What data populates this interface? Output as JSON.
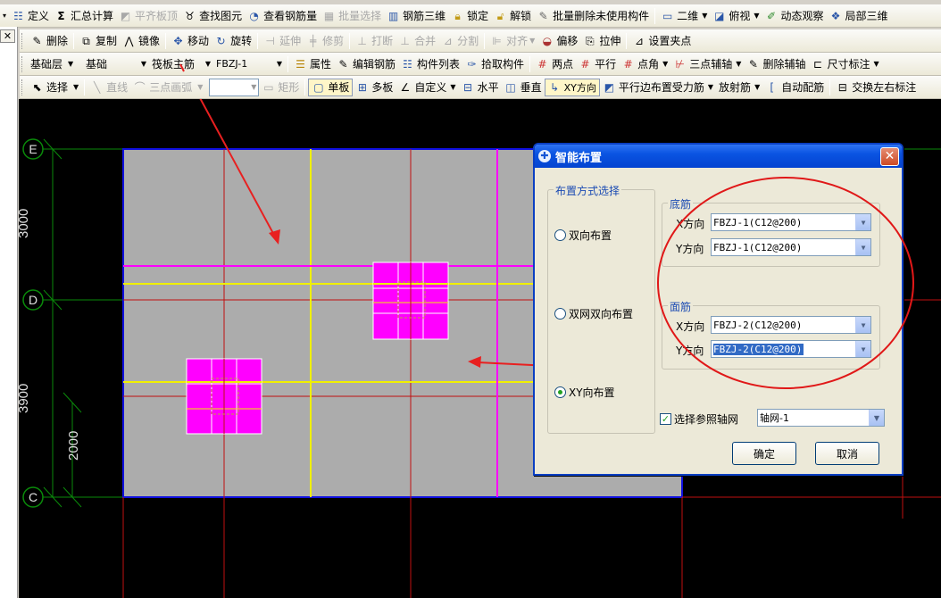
{
  "toolbar1": {
    "items": [
      {
        "label": "定义",
        "icon": "define-icon"
      },
      {
        "label": "汇总计算",
        "icon": "sigma-icon"
      },
      {
        "label": "平齐板顶",
        "icon": "align-top-icon",
        "disabled": true
      },
      {
        "label": "查找图元",
        "icon": "binoculars-icon"
      },
      {
        "label": "查看钢筋量",
        "icon": "view-rebar-icon"
      },
      {
        "label": "批量选择",
        "icon": "batch-select-icon",
        "disabled": true
      },
      {
        "label": "钢筋三维",
        "icon": "rebar-3d-icon"
      },
      {
        "label": "锁定",
        "icon": "lock-icon"
      },
      {
        "label": "解锁",
        "icon": "unlock-icon"
      },
      {
        "label": "批量删除未使用构件",
        "icon": "batch-delete-icon"
      },
      {
        "label": "二维",
        "icon": "2d-icon"
      },
      {
        "label": "俯视",
        "icon": "top-view-icon"
      },
      {
        "label": "动态观察",
        "icon": "orbit-icon"
      },
      {
        "label": "局部三维",
        "icon": "local-3d-icon"
      }
    ]
  },
  "toolbar2": {
    "items": [
      {
        "label": "删除",
        "icon": "delete-icon"
      },
      {
        "label": "复制",
        "icon": "copy-icon"
      },
      {
        "label": "镜像",
        "icon": "mirror-icon"
      },
      {
        "label": "移动",
        "icon": "move-icon"
      },
      {
        "label": "旋转",
        "icon": "rotate-icon"
      },
      {
        "label": "延伸",
        "icon": "extend-icon",
        "disabled": true
      },
      {
        "label": "修剪",
        "icon": "trim-icon",
        "disabled": true
      },
      {
        "label": "打断",
        "icon": "break-icon",
        "disabled": true
      },
      {
        "label": "合并",
        "icon": "merge-icon",
        "disabled": true
      },
      {
        "label": "分割",
        "icon": "split-icon",
        "disabled": true
      },
      {
        "label": "对齐",
        "icon": "align-icon",
        "disabled": true
      },
      {
        "label": "偏移",
        "icon": "offset-icon"
      },
      {
        "label": "拉伸",
        "icon": "stretch-icon"
      },
      {
        "label": "设置夹点",
        "icon": "grip-point-icon"
      }
    ]
  },
  "toolbar3": {
    "floor": "基础层",
    "category": "基础",
    "component_type": "筏板主筋",
    "component_name": "FBZJ-1",
    "items": [
      {
        "label": "属性",
        "icon": "property-icon"
      },
      {
        "label": "编辑钢筋",
        "icon": "edit-rebar-icon"
      },
      {
        "label": "构件列表",
        "icon": "component-list-icon"
      },
      {
        "label": "拾取构件",
        "icon": "pick-component-icon"
      },
      {
        "label": "两点",
        "icon": "two-point-icon"
      },
      {
        "label": "平行",
        "icon": "parallel-icon"
      },
      {
        "label": "点角",
        "icon": "point-angle-icon"
      },
      {
        "label": "三点辅轴",
        "icon": "three-point-axis-icon"
      },
      {
        "label": "删除辅轴",
        "icon": "delete-axis-icon"
      },
      {
        "label": "尺寸标注",
        "icon": "dimension-icon"
      }
    ]
  },
  "toolbar4": {
    "select": "选择",
    "line": "直线",
    "arc": "三点画弧",
    "rect": "矩形",
    "items": [
      {
        "label": "单板",
        "icon": "single-slab-icon",
        "active": true
      },
      {
        "label": "多板",
        "icon": "multi-slab-icon"
      },
      {
        "label": "自定义",
        "icon": "custom-icon"
      },
      {
        "label": "水平",
        "icon": "horizontal-icon"
      },
      {
        "label": "垂直",
        "icon": "vertical-icon"
      },
      {
        "label": "XY方向",
        "icon": "xy-direction-icon",
        "active": true
      },
      {
        "label": "平行边布置受力筋",
        "icon": "parallel-edge-icon"
      },
      {
        "label": "放射筋",
        "icon": "radial-icon"
      },
      {
        "label": "自动配筋",
        "icon": "auto-rebar-icon"
      },
      {
        "label": "交换左右标注",
        "icon": "swap-label-icon"
      }
    ]
  },
  "drawing": {
    "axes": [
      "E",
      "D",
      "C"
    ],
    "dims": [
      "3000",
      "3900",
      "2000"
    ]
  },
  "dialog": {
    "title": "智能布置",
    "layout_group": "布置方式选择",
    "options": [
      "双向布置",
      "双网双向布置",
      "XY向布置"
    ],
    "selected_option": "XY向布置",
    "bottom_group": "底筋",
    "top_group": "面筋",
    "x_dir_label": "X方向",
    "y_dir_label": "Y方向",
    "bottom_x": "FBZJ-1(C12@200)",
    "bottom_y": "FBZJ-1(C12@200)",
    "top_x": "FBZJ-2(C12@200)",
    "top_y": "FBZJ-2(C12@200)",
    "ref_axis_checkbox": "选择参照轴网",
    "ref_axis_checked": true,
    "ref_axis_value": "轴网-1",
    "ok": "确定",
    "cancel": "取消"
  }
}
